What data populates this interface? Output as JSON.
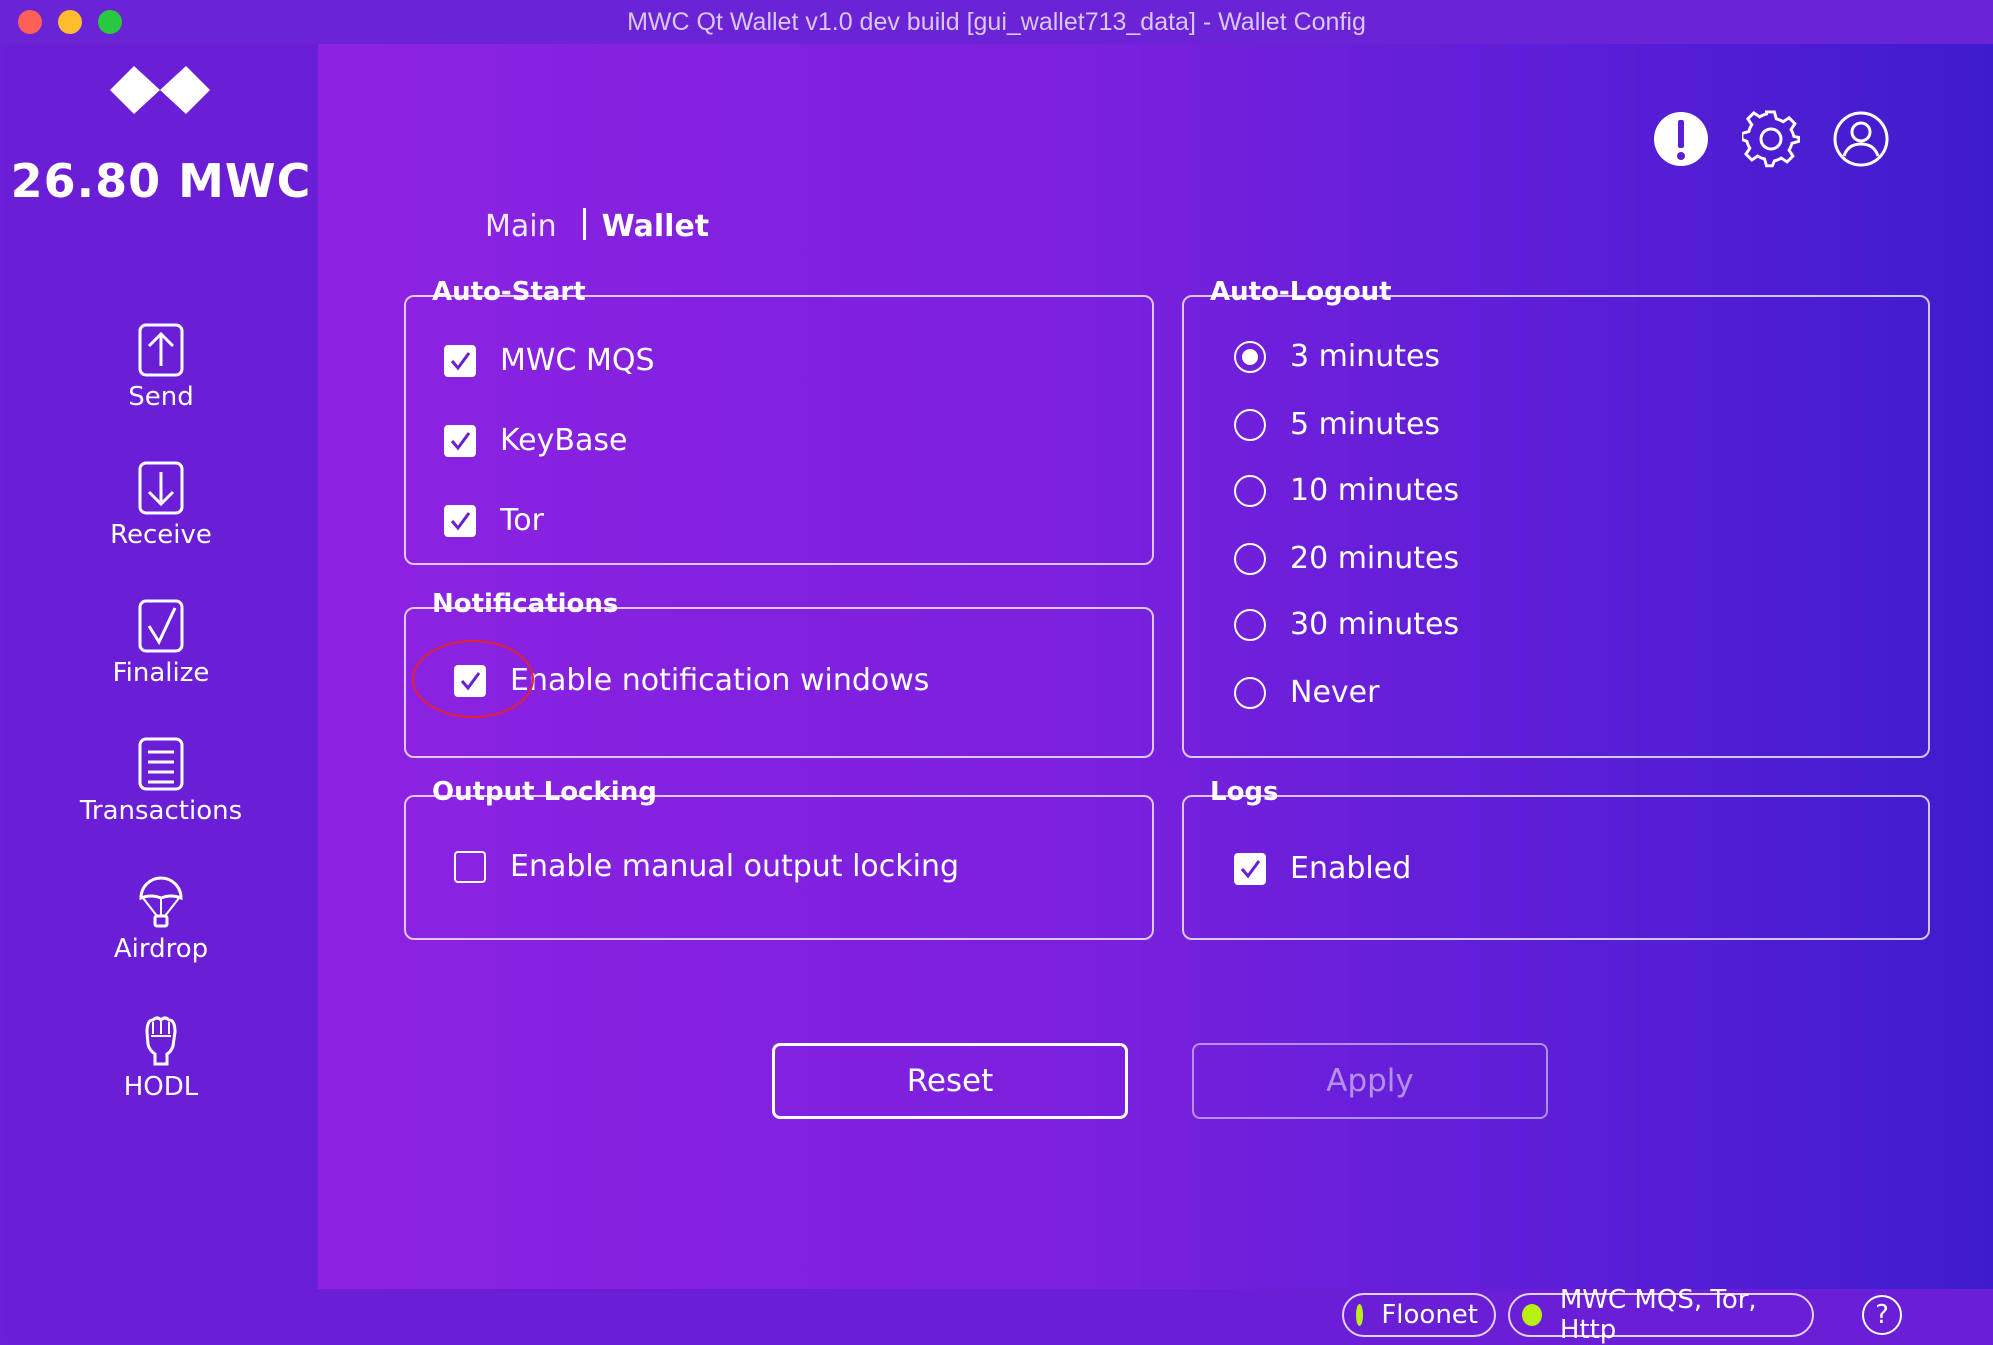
{
  "window": {
    "title": "MWC Qt Wallet v1.0 dev build [gui_wallet713_data] - Wallet Config"
  },
  "sidebar": {
    "balance": "26.80 MWC",
    "items": [
      {
        "label": "Send",
        "icon": "send-icon"
      },
      {
        "label": "Receive",
        "icon": "receive-icon"
      },
      {
        "label": "Finalize",
        "icon": "finalize-icon"
      },
      {
        "label": "Transactions",
        "icon": "transactions-icon"
      },
      {
        "label": "Airdrop",
        "icon": "airdrop-icon"
      },
      {
        "label": "HODL",
        "icon": "hodl-icon"
      }
    ]
  },
  "header": {
    "icons": [
      "alert-icon",
      "settings-gear-icon",
      "account-icon"
    ]
  },
  "tabs": {
    "main": "Main",
    "wallet": "Wallet",
    "active": "Wallet"
  },
  "auto_start": {
    "title": "Auto-Start",
    "options": [
      {
        "label": "MWC MQS",
        "checked": true
      },
      {
        "label": "KeyBase",
        "checked": true
      },
      {
        "label": "Tor",
        "checked": true
      }
    ]
  },
  "auto_logout": {
    "title": "Auto-Logout",
    "options": [
      "3 minutes",
      "5 minutes",
      "10 minutes",
      "20 minutes",
      "30 minutes",
      "Never"
    ],
    "selected": "3 minutes"
  },
  "notifications": {
    "title": "Notifications",
    "option": {
      "label": "Enable notification windows",
      "checked": true
    }
  },
  "output_locking": {
    "title": "Output Locking",
    "option": {
      "label": "Enable manual output locking",
      "checked": false
    }
  },
  "logs": {
    "title": "Logs",
    "option": {
      "label": "Enabled",
      "checked": true
    }
  },
  "buttons": {
    "reset": "Reset",
    "apply": "Apply"
  },
  "status": {
    "network": "Floonet",
    "listeners": "MWC MQS, Tor, Http",
    "help": "?",
    "led_color": "#b8f016"
  }
}
